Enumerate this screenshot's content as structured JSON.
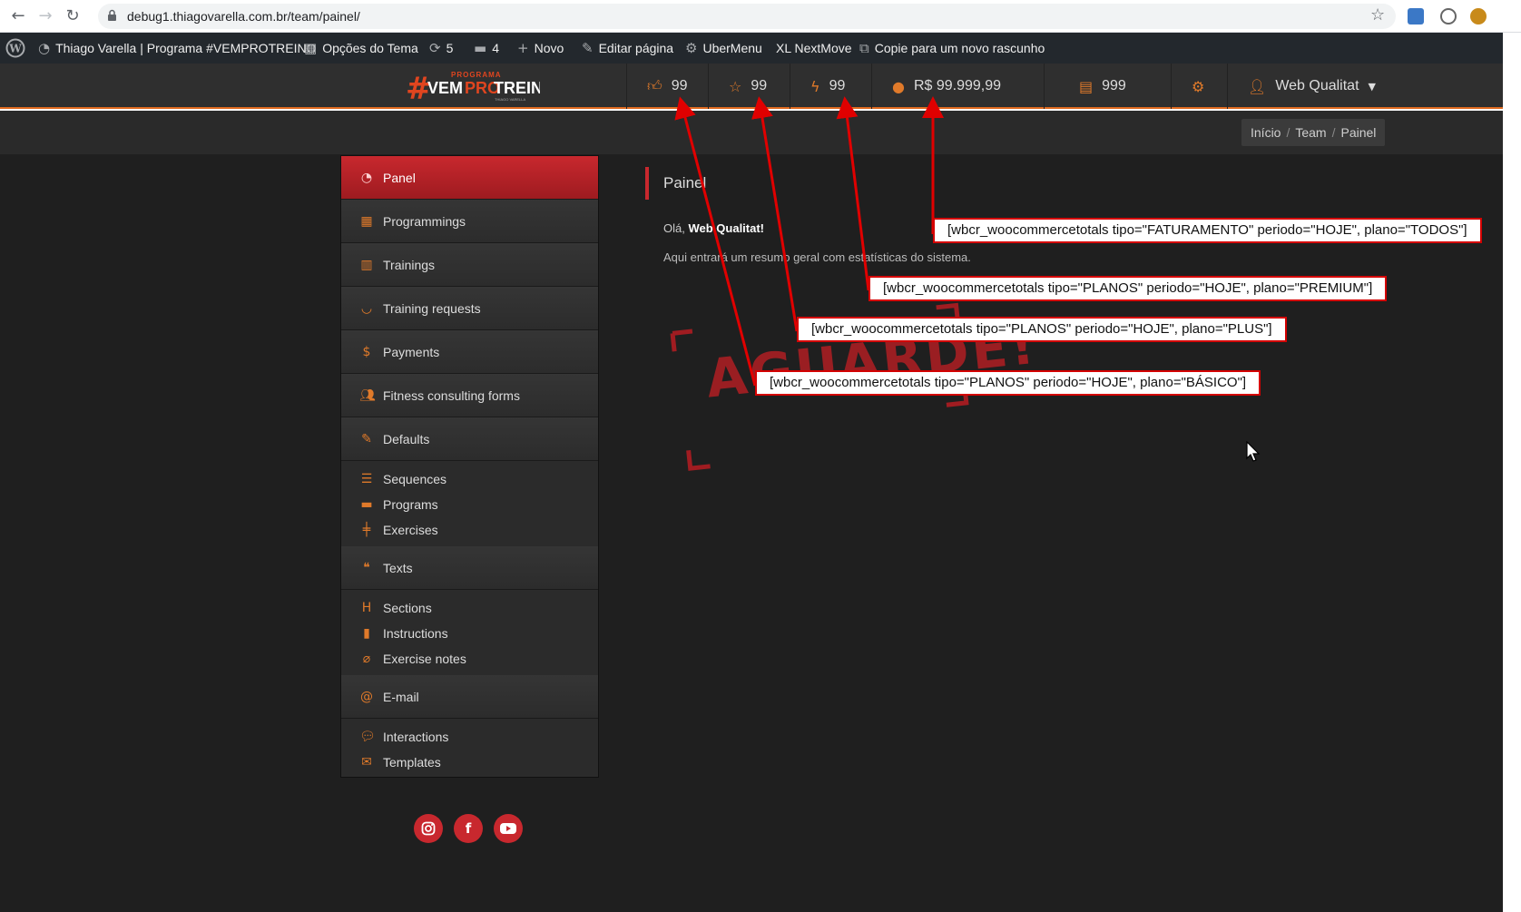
{
  "browser": {
    "url": "debug1.thiagovarella.com.br/team/painel/"
  },
  "wp_admin_bar": {
    "site_name": "Thiago Varella | Programa #VEMPROTREINO",
    "theme_options": "Opções do Tema",
    "updates_count": "5",
    "comments_count": "4",
    "new_label": "Novo",
    "edit_page": "Editar página",
    "ubermenu": "UberMenu",
    "xl_nextmove": "XL NextMove",
    "copy_draft": "Copie para um novo rascunho"
  },
  "logo": {
    "hash": "#",
    "small": "PROGRAMA",
    "part1": "VEM",
    "part2": "PRO",
    "part3": "TREINO",
    "tagline": "THIAGO VARELLA"
  },
  "stats": {
    "likes": "99",
    "stars": "99",
    "bolts": "99",
    "revenue": "R$ 99.999,99",
    "documents": "999",
    "user": "Web Qualitat"
  },
  "breadcrumb": [
    "Início",
    "Team",
    "Painel"
  ],
  "sidebar": {
    "items": [
      {
        "label": "Panel"
      },
      {
        "label": "Programmings"
      },
      {
        "label": "Trainings"
      },
      {
        "label": "Training requests"
      },
      {
        "label": "Payments"
      },
      {
        "label": "Fitness consulting forms"
      },
      {
        "label": "Defaults"
      },
      {
        "label": "Texts"
      },
      {
        "label": "E-mail"
      }
    ],
    "defaults_sub": [
      "Sequences",
      "Programs",
      "Exercises"
    ],
    "texts_sub": [
      "Sections",
      "Instructions",
      "Exercise notes"
    ],
    "email_sub": [
      "Interactions",
      "Templates"
    ]
  },
  "content": {
    "title": "Painel",
    "greeting_prefix": "Olá,",
    "greeting_name": "Web Qualitat!",
    "summary": "Aqui entrará um resumo geral com estatísticas do sistema.",
    "stamp": "AGUARDE!"
  },
  "annotations": [
    "[wbcr_woocommercetotals tipo=\"FATURAMENTO\" periodo=\"HOJE\", plano=\"TODOS\"]",
    "[wbcr_woocommercetotals tipo=\"PLANOS\" periodo=\"HOJE\", plano=\"PREMIUM\"]",
    "[wbcr_woocommercetotals tipo=\"PLANOS\" periodo=\"HOJE\", plano=\"PLUS\"]",
    "[wbcr_woocommercetotals tipo=\"PLANOS\" periodo=\"HOJE\", plano=\"BÁSICO\"]"
  ],
  "colors": {
    "accent_red": "#c8282e",
    "accent_orange": "#e07a2a",
    "annotation_red": "#d40000",
    "background_dark": "#1f1f1f"
  }
}
